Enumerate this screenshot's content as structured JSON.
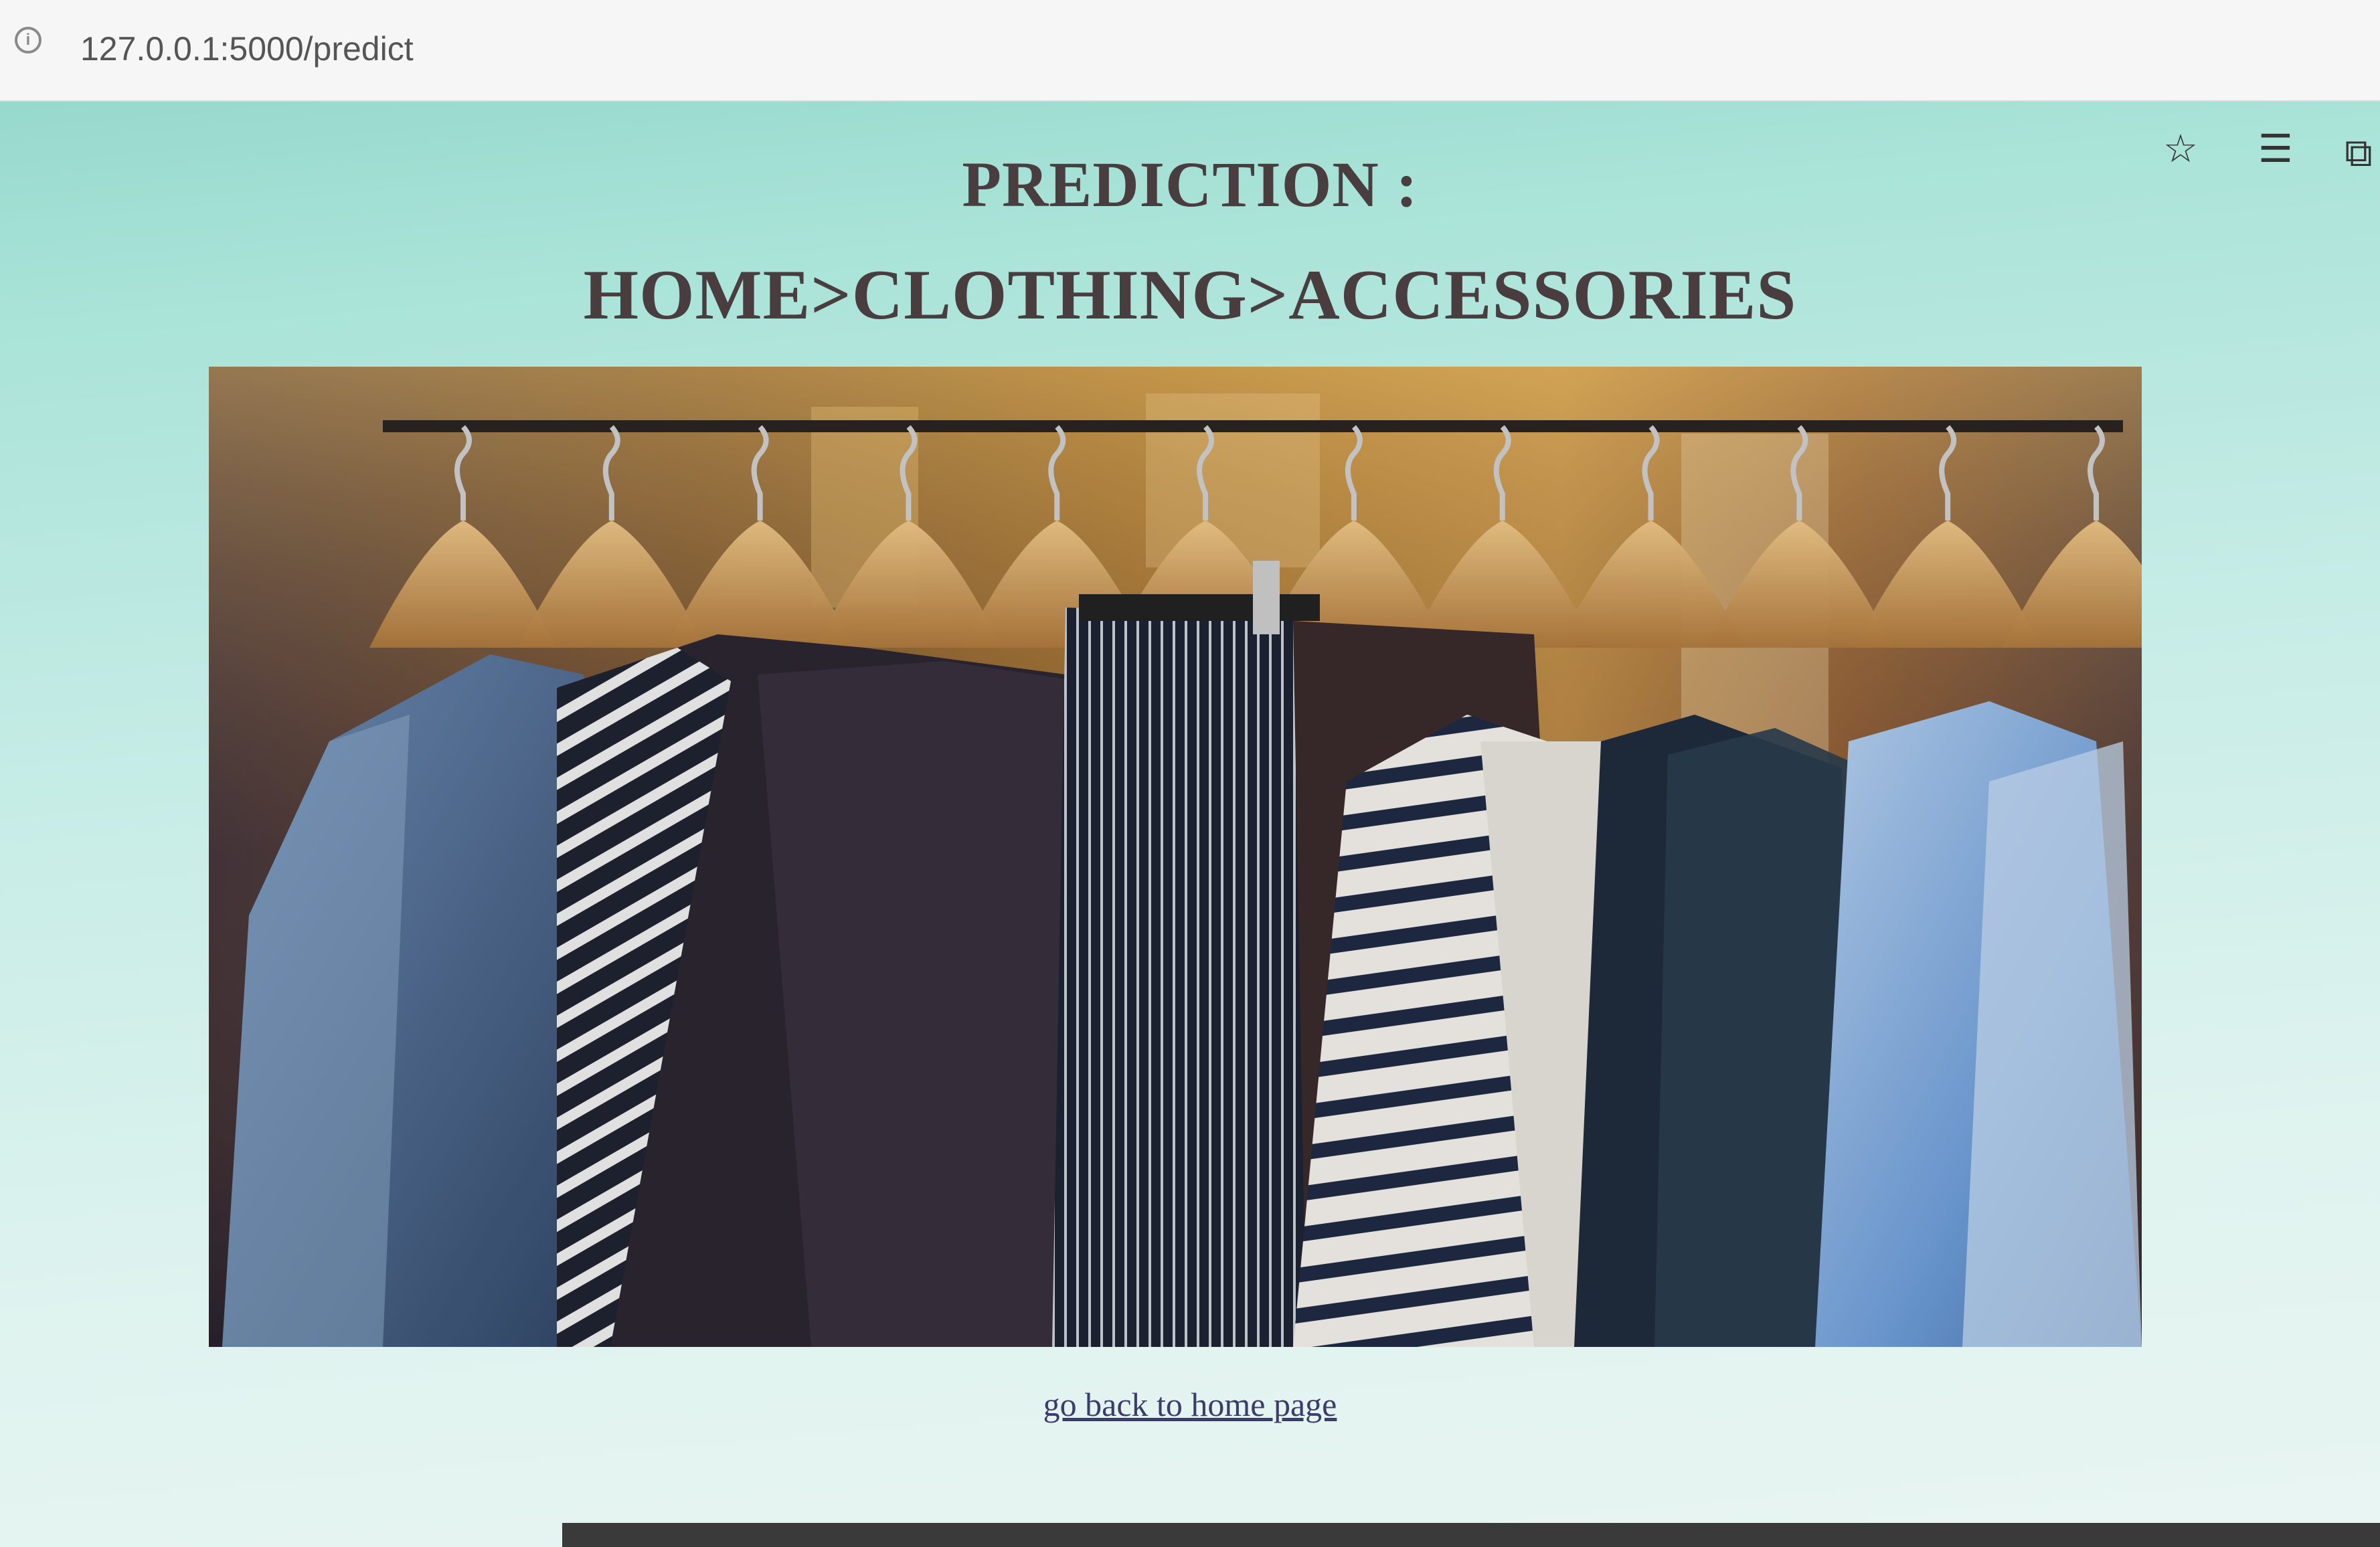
{
  "browser": {
    "url": "127.0.0.1:5000/predict",
    "icons": [
      "info-icon",
      "star-icon",
      "reading-list-icon",
      "collections-icon"
    ]
  },
  "page": {
    "title": "PREDICTION :",
    "prediction": "HOME>CLOTHING>ACCESSORIES",
    "link_text": "go back to home page",
    "image_subject": "clothes on wooden hangers on a rack"
  },
  "colors": {
    "heading": "#4a3d3f",
    "link": "#3b3b6e",
    "background": "#a9e3d8"
  }
}
